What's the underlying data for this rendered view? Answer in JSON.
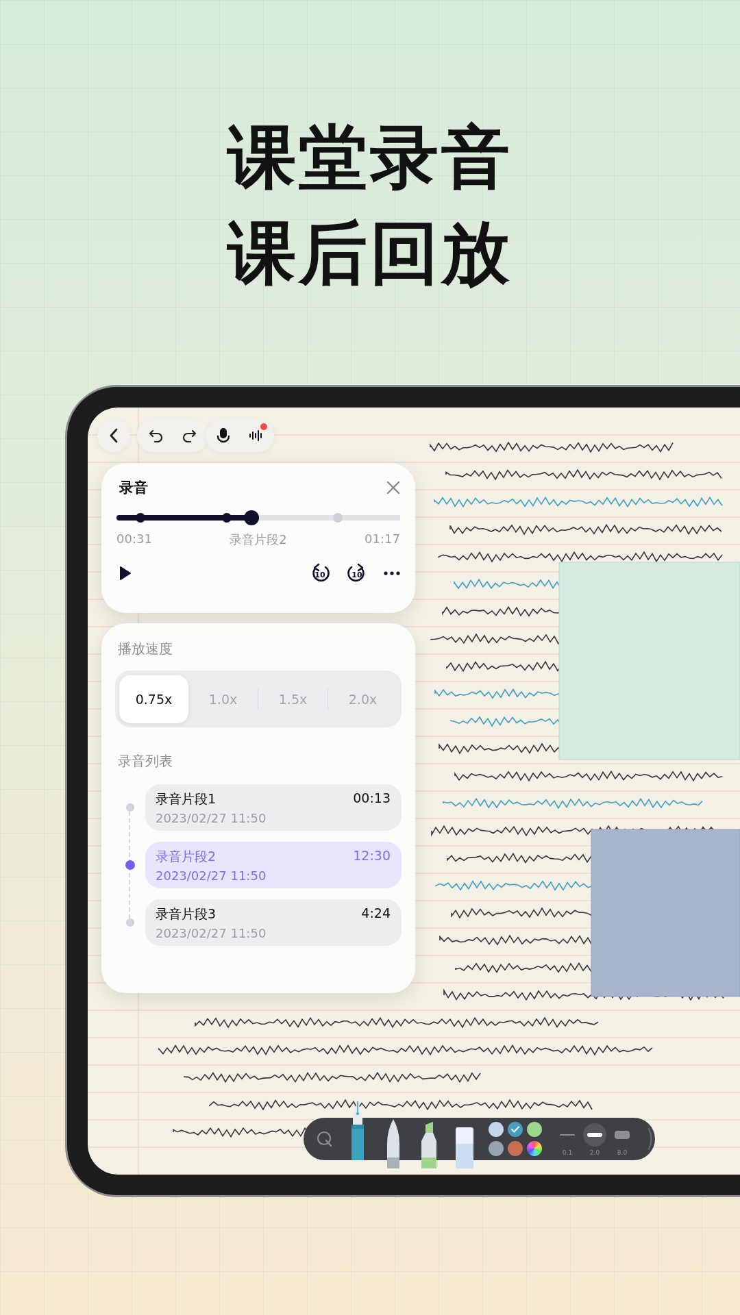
{
  "headline": [
    "课堂录音",
    "课后回放"
  ],
  "top_bar": {
    "recording": true
  },
  "recorder": {
    "title": "录音",
    "level": 0.475,
    "elapsed": "00:31",
    "segment": "录音片段2",
    "total": "01:17",
    "skip_back_label": "10",
    "skip_forward_label": "10"
  },
  "speed": {
    "title": "播放速度",
    "options": [
      {
        "label": "0.75x",
        "selected": true
      },
      {
        "label": "1.0x",
        "selected": false
      },
      {
        "label": "1.5x",
        "selected": false
      },
      {
        "label": "2.0x",
        "selected": false
      }
    ]
  },
  "recordings": {
    "title": "录音列表",
    "items": [
      {
        "name": "录音片段1",
        "duration": "00:13",
        "date": "2023/02/27 11:50",
        "selected": false
      },
      {
        "name": "录音片段2",
        "duration": "12:30",
        "date": "2023/02/27 11:50",
        "selected": true
      },
      {
        "name": "录音片段3",
        "duration": "4:24",
        "date": "2023/02/27 11:50",
        "selected": false
      }
    ]
  },
  "pen_toolbar": {
    "tools": [
      {
        "kind": "fountain-pen",
        "selected": true
      },
      {
        "kind": "pencil",
        "selected": false
      },
      {
        "kind": "highlighter",
        "selected": false
      },
      {
        "kind": "eraser",
        "selected": false
      }
    ],
    "swatches": [
      {
        "kind": "solid",
        "color": "#c3d5ea",
        "selected": false
      },
      {
        "kind": "solid",
        "color": "#4a9fc0",
        "selected": true
      },
      {
        "kind": "solid",
        "color": "#9ed88f",
        "selected": false
      },
      {
        "kind": "solid",
        "color": "#95a3b3",
        "selected": false
      },
      {
        "kind": "solid",
        "color": "#c96f55",
        "selected": false
      },
      {
        "kind": "spectrum",
        "selected": false
      }
    ],
    "widths": [
      {
        "label": "0.1",
        "selected": false
      },
      {
        "label": "2.0",
        "selected": true
      },
      {
        "label": "8.0",
        "selected": false
      }
    ]
  }
}
